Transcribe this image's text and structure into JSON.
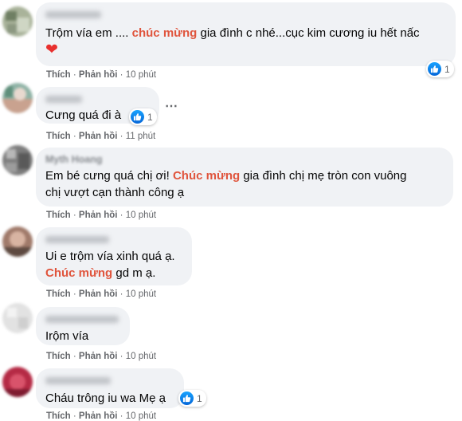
{
  "comments": [
    {
      "author": "▬▬▬▬▬▬",
      "text_parts": [
        "Trộm vía em .... ",
        "chúc mừng",
        " gia đình c nhé...cục kim cương iu hết nấc"
      ],
      "emoji": "heart",
      "emoji_char": "❤",
      "actions": {
        "like": "Thích",
        "reply": "Phản hồi",
        "time": "10 phút"
      },
      "reaction_count": "1"
    },
    {
      "author": "▬▬▬▬",
      "text": "Cưng quá đi à",
      "actions": {
        "like": "Thích",
        "reply": "Phản hồi",
        "time": "11 phút"
      },
      "reaction_count": "1",
      "more": "⋯"
    },
    {
      "author": "Myth Hoang",
      "text_parts": [
        "Em bé cưng quá chị ơi! ",
        "Chúc mừng",
        " gia đình chị mẹ tròn con vuông"
      ],
      "text_line2": "chị vượt cạn thành công ạ",
      "actions": {
        "like": "Thích",
        "reply": "Phản hồi",
        "time": "10 phút"
      }
    },
    {
      "author": "▬▬▬▬▬▬",
      "text": "Ui e trộm vía xinh quá ạ.",
      "text_parts_line2": [
        "Chúc mừng",
        " gd m ạ."
      ],
      "actions": {
        "like": "Thích",
        "reply": "Phản hồi",
        "time": "10 phút"
      }
    },
    {
      "author": "▬▬▬▬▬▬▬",
      "text": "Irộm vía",
      "actions": {
        "like": "Thích",
        "reply": "Phản hồi",
        "time": "10 phút"
      }
    },
    {
      "author": "▬▬▬▬▬▬",
      "text": "Cháu trông iu wa Mẹ ạ",
      "actions": {
        "like": "Thích",
        "reply": "Phản hồi",
        "time": "10 phút"
      },
      "reaction_count": "1"
    }
  ],
  "colors": {
    "bubble": "#f0f2f5",
    "highlight": "#e0553d",
    "like_blue": "#1877f2",
    "meta_gray": "#65676b"
  },
  "icons": {
    "reaction": "like-thumb-icon",
    "more": "more-options-icon"
  }
}
